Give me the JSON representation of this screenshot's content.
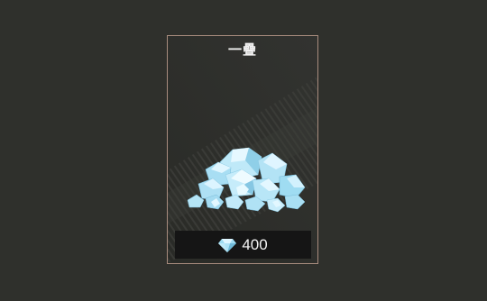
{
  "card": {
    "title": "一疊",
    "image_icon": "diamond-pile-icon",
    "price": {
      "currency_icon": "diamond-icon",
      "value": "400"
    }
  },
  "colors": {
    "background": "#2f302c",
    "card_border": "#a88c7e",
    "price_bar": "#151515",
    "gem_light": "#cdeefa",
    "gem_mid": "#9fdcf2",
    "gem_dark": "#6bb8d6"
  }
}
